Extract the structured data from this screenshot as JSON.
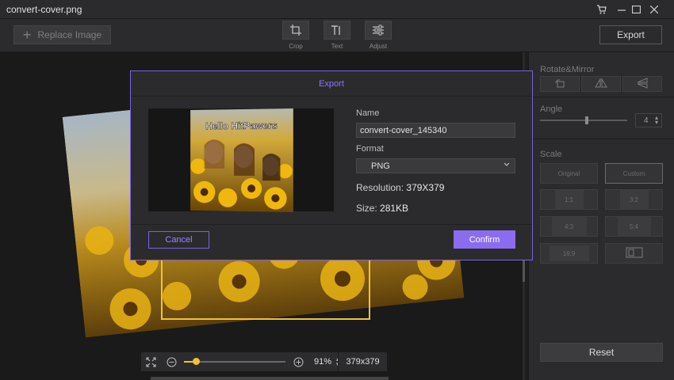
{
  "window": {
    "title": "convert-cover.png"
  },
  "toolbar": {
    "replace_label": "Replace Image",
    "tools": [
      {
        "label": "Crop",
        "icon": "crop-icon"
      },
      {
        "label": "Text",
        "icon": "text-icon"
      },
      {
        "label": "Adjust",
        "icon": "adjust-icon"
      }
    ],
    "export_label": "Export"
  },
  "canvas": {
    "zoom_percent": "91%",
    "zoom_level": 0.12,
    "resolution": "379x379"
  },
  "panel": {
    "rotate_label": "Rotate&Mirror",
    "angle_label": "Angle",
    "angle_value": "4",
    "scale_label": "Scale",
    "scale_options": [
      "Original",
      "Custom",
      "1:1",
      "3:2",
      "4:3",
      "5:4",
      "16:9",
      ""
    ],
    "reset_label": "Reset"
  },
  "modal": {
    "title": "Export",
    "thumb_caption": "Hello HitPawers",
    "name_label": "Name",
    "name_value": "convert-cover_145340",
    "format_label": "Format",
    "format_value": "PNG",
    "resolution_label": "Resolution:",
    "resolution_value": "379X379",
    "size_label": "Size:",
    "size_value": "281KB",
    "cancel_label": "Cancel",
    "confirm_label": "Confirm"
  },
  "colors": {
    "accent": "#8b6cf0",
    "highlight": "#f1c232"
  }
}
